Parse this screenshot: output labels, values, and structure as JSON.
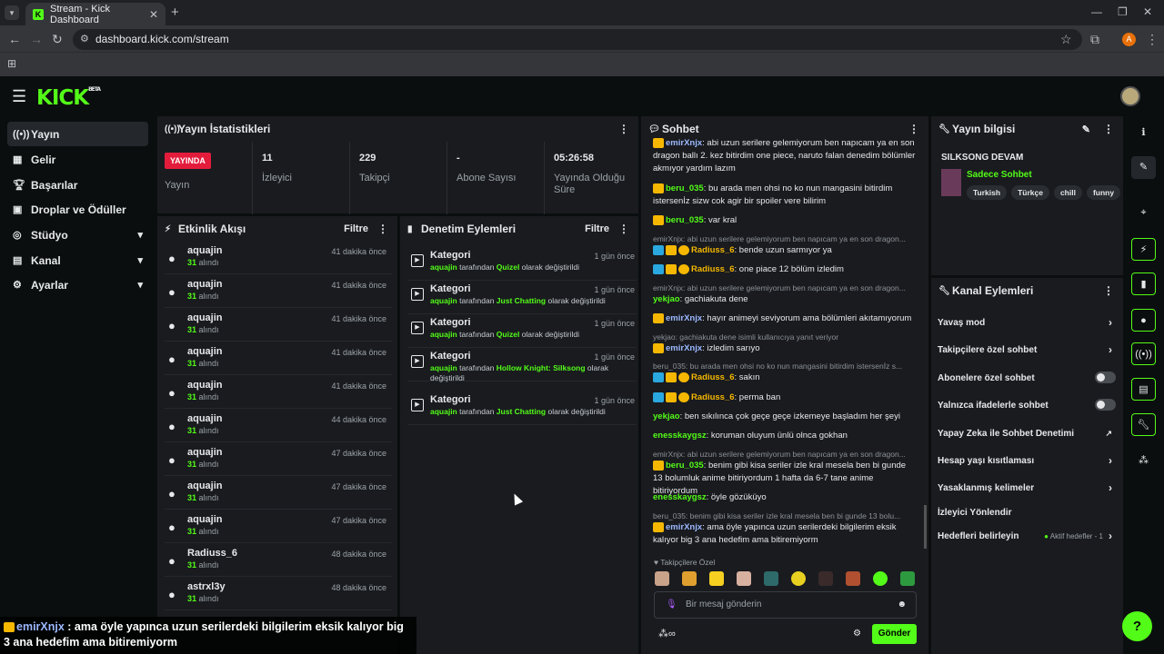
{
  "browser": {
    "tab_title": "Stream - Kick Dashboard",
    "url": "dashboard.kick.com/stream",
    "profile_initial": "A"
  },
  "brand": {
    "logo": "KICK",
    "beta": "BETA",
    "accent": "#53fc18"
  },
  "sidebar": {
    "items": [
      {
        "label": "Yayın",
        "icon": "broadcast-icon"
      },
      {
        "label": "Gelir",
        "icon": "revenue-icon"
      },
      {
        "label": "Başarılar",
        "icon": "trophy-icon"
      },
      {
        "label": "Droplar ve Ödüller",
        "icon": "gift-icon"
      },
      {
        "label": "Stüdyo",
        "icon": "studio-icon"
      },
      {
        "label": "Kanal",
        "icon": "channel-icon"
      },
      {
        "label": "Ayarlar",
        "icon": "gear-icon"
      }
    ]
  },
  "stats": {
    "title": "Yayın İstatistikleri",
    "live": "YAYINDA",
    "live_label": "Yayın",
    "viewers": "11",
    "viewers_label": "İzleyici",
    "followers": "229",
    "followers_label": "Takipçi",
    "subs": "-",
    "subs_label": "Abone Sayısı",
    "uptime": "05:26:58",
    "uptime_label": "Yayında Olduğu Süre"
  },
  "events": {
    "title": "Etkinlik Akışı",
    "filter": "Filtre",
    "items": [
      {
        "name": "aquajin",
        "sub": "31",
        "suffix": "alındı",
        "time": "41 dakika önce"
      },
      {
        "name": "aquajin",
        "sub": "31",
        "suffix": "alındı",
        "time": "41 dakika önce"
      },
      {
        "name": "aquajin",
        "sub": "31",
        "suffix": "alındı",
        "time": "41 dakika önce"
      },
      {
        "name": "aquajin",
        "sub": "31",
        "suffix": "alındı",
        "time": "41 dakika önce"
      },
      {
        "name": "aquajin",
        "sub": "31",
        "suffix": "alındı",
        "time": "41 dakika önce"
      },
      {
        "name": "aquajin",
        "sub": "31",
        "suffix": "alındı",
        "time": "44 dakika önce"
      },
      {
        "name": "aquajin",
        "sub": "31",
        "suffix": "alındı",
        "time": "47 dakika önce"
      },
      {
        "name": "aquajin",
        "sub": "31",
        "suffix": "alındı",
        "time": "47 dakika önce"
      },
      {
        "name": "aquajin",
        "sub": "31",
        "suffix": "alındı",
        "time": "47 dakika önce"
      },
      {
        "name": "Radiuss_6",
        "sub": "31",
        "suffix": "alındı",
        "time": "48 dakika önce"
      },
      {
        "name": "astrxl3y",
        "sub": "31",
        "suffix": "alındı",
        "time": "48 dakika önce"
      }
    ]
  },
  "mod": {
    "title": "Denetim Eylemleri",
    "filter": "Filtre",
    "items": [
      {
        "title": "Kategori",
        "user": "aquajin",
        "mid": "tarafından",
        "cat": "Quizel",
        "end": "olarak değiştirildi",
        "time": "1 gün önce"
      },
      {
        "title": "Kategori",
        "user": "aquajin",
        "mid": "tarafından",
        "cat": "Just Chatting",
        "end": "olarak değiştirildi",
        "time": "1 gün önce"
      },
      {
        "title": "Kategori",
        "user": "aquajin",
        "mid": "tarafından",
        "cat": "Quizel",
        "end": "olarak değiştirildi",
        "time": "1 gün önce"
      },
      {
        "title": "Kategori",
        "user": "aquajin",
        "mid": "tarafından",
        "cat": "Hollow Knight: Silksong",
        "end": "olarak değiştirildi",
        "time": "1 gün önce"
      },
      {
        "title": "Kategori",
        "user": "aquajin",
        "mid": "tarafından",
        "cat": "Just Chatting",
        "end": "olarak değiştirildi",
        "time": "1 gün önce"
      }
    ]
  },
  "chat": {
    "title": "Sohbet",
    "followers_only": "Takipçilere Özel",
    "placeholder": "Bir mesaj gönderin",
    "send": "Gönder",
    "m1_user": "emirXnjx",
    "m1_text": ": abi uzun serilere gelemiyorum ben napıcam ya en son dragon ballı 2. kez bitirdim one piece, naruto falan denedim bölümler akmıyor yardım lazım",
    "m2_user": "beru_035",
    "m2_text": ": bu arada men ohsi no ko nun mangasini bitirdim istersenİz sizw cok agir bir spoiler vere bilirim",
    "m3_user": "beru_035",
    "m3_text": ": var kral",
    "r1": "emirXnjx: abi uzun serilere gelemiyorum ben napıcam ya en son dragon...",
    "m4_user": "Radiuss_6",
    "m4_text": ": bende uzun sarmıyor ya",
    "m5_user": "Radiuss_6",
    "m5_text": ": one piace 12 bölüm izledim",
    "r2": "emirXnjx: abi uzun serilere gelemiyorum ben napıcam ya en son dragon...",
    "m6_user": "yekjao",
    "m6_text": ": gachiakuta dene",
    "m7_user": "emirXnjx",
    "m7_text": ": hayır animeyi seviyorum ama bölümleri akıtamıyorum",
    "r3": "yekjao: gachiakuta dene isimli kullanıcıya yanıt veriyor",
    "m8_user": "emirXnjx",
    "m8_text": ": izledim sarıyo",
    "r4": "beru_035: bu arada men ohsi no ko nun mangasini bitirdim istersenİz s...",
    "m9_user": "Radiuss_6",
    "m9_text": ": sakın",
    "m10_user": "Radiuss_6",
    "m10_text": ": perma ban",
    "m11_user": "yekjao",
    "m11_text": ": ben sıkılınca çok geçe geçe izkemeye başladım her şeyi",
    "m12_user": "enesskaygsz",
    "m12_text": ": koruman oluyum ünlü olnca gokhan",
    "r5": "emirXnjx: abi uzun serilere gelemiyorum ben napıcam ya en son dragon...",
    "m13_user": "beru_035",
    "m13_text": ": benim gibi kisa seriler izle kral mesela ben bi gunde 13 bolumluk anime bitiriyordum 1 hafta da 6-7 tane anime bitiriyordum",
    "m14_user": "enesskaygsz",
    "m14_text": ": öyle gözüküyo",
    "r6": "beru_035: benim gibi kisa seriler izle kral mesela ben bi gunde 13 bolu...",
    "m15_user": "emirXnjx",
    "m15_text": ": ama öyle yapınca uzun serilerdeki bilgilerim eksik kalıyor big 3 ana hedefim ama bitiremiyorm"
  },
  "info": {
    "title": "Yayın bilgisi",
    "stream_title": "SILKSONG DEVAM",
    "category": "Sadece Sohbet",
    "tags": [
      "Turkish",
      "Türkçe",
      "chill",
      "funny"
    ]
  },
  "actions": {
    "title": "Kanal Eylemleri",
    "items": [
      {
        "label": "Yavaş mod"
      },
      {
        "label": "Takipçilere özel sohbet"
      },
      {
        "label": "Abonelere özel sohbet"
      },
      {
        "label": "Yalnızca ifadelerle sohbet"
      },
      {
        "label": "Yapay Zeka ile Sohbet Denetimi"
      },
      {
        "label": "Hesap yaşı kısıtlaması"
      },
      {
        "label": "Yasaklanmış kelimeler"
      },
      {
        "label": "İzleyici Yönlendir"
      },
      {
        "label": "Hedefleri belirleyin"
      }
    ],
    "goals_status": "Aktif hedefler - 1"
  },
  "caption": {
    "user": "emirXnjx",
    "text": " : ama öyle yapınca uzun serilerdeki bilgilerim eksik kalıyor big 3 ana hedefim ama bitiremiyorm"
  }
}
